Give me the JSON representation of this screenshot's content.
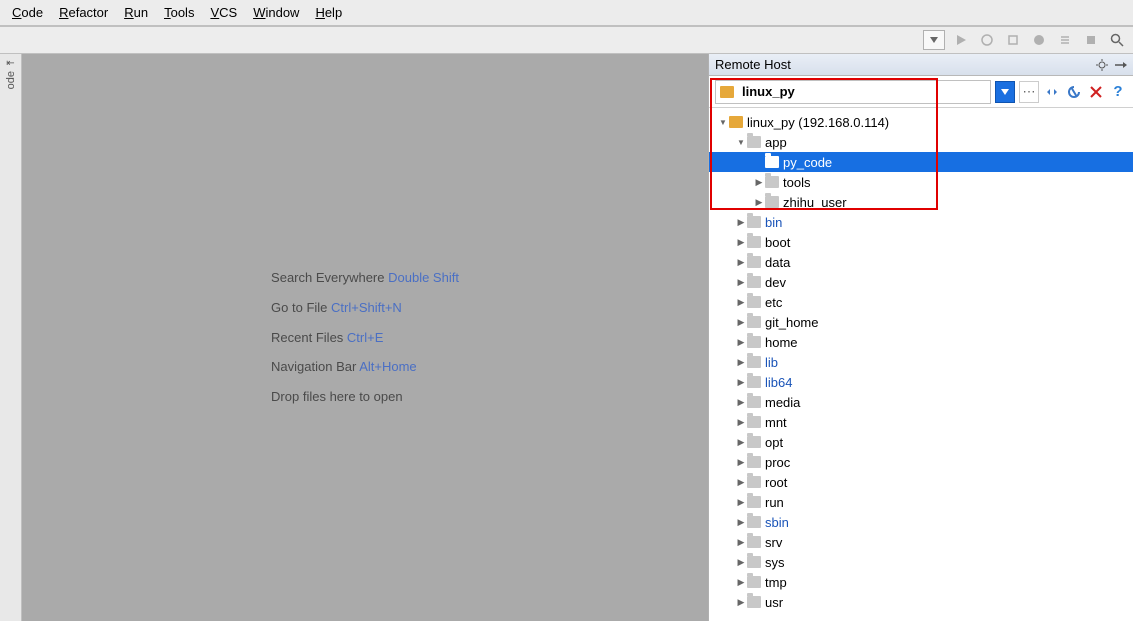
{
  "menu": [
    "Code",
    "Refactor",
    "Run",
    "Tools",
    "VCS",
    "Window",
    "Help"
  ],
  "leftbar": {
    "label": "ode"
  },
  "editor_hints": [
    {
      "label": "Search Everywhere ",
      "shortcut": "Double Shift"
    },
    {
      "label": "Go to File ",
      "shortcut": "Ctrl+Shift+N"
    },
    {
      "label": "Recent Files ",
      "shortcut": "Ctrl+E"
    },
    {
      "label": "Navigation Bar ",
      "shortcut": "Alt+Home"
    },
    {
      "label": "Drop files here to open",
      "shortcut": ""
    }
  ],
  "panel": {
    "title": "Remote Host",
    "server_name": "linux_py"
  },
  "tree": [
    {
      "depth": 0,
      "arrow": "down",
      "icon": "server",
      "label": "linux_py (192.168.0.114)",
      "link": false,
      "selected": false
    },
    {
      "depth": 1,
      "arrow": "down",
      "icon": "folder",
      "label": "app",
      "link": false,
      "selected": false
    },
    {
      "depth": 2,
      "arrow": "",
      "icon": "folder",
      "label": "py_code",
      "link": false,
      "selected": true
    },
    {
      "depth": 2,
      "arrow": "right",
      "icon": "folder",
      "label": "tools",
      "link": false,
      "selected": false
    },
    {
      "depth": 2,
      "arrow": "right",
      "icon": "folder",
      "label": "zhihu_user",
      "link": false,
      "selected": false
    },
    {
      "depth": 1,
      "arrow": "right",
      "icon": "folder",
      "label": "bin",
      "link": true,
      "selected": false
    },
    {
      "depth": 1,
      "arrow": "right",
      "icon": "folder",
      "label": "boot",
      "link": false,
      "selected": false
    },
    {
      "depth": 1,
      "arrow": "right",
      "icon": "folder",
      "label": "data",
      "link": false,
      "selected": false
    },
    {
      "depth": 1,
      "arrow": "right",
      "icon": "folder",
      "label": "dev",
      "link": false,
      "selected": false
    },
    {
      "depth": 1,
      "arrow": "right",
      "icon": "folder",
      "label": "etc",
      "link": false,
      "selected": false
    },
    {
      "depth": 1,
      "arrow": "right",
      "icon": "folder",
      "label": "git_home",
      "link": false,
      "selected": false
    },
    {
      "depth": 1,
      "arrow": "right",
      "icon": "folder",
      "label": "home",
      "link": false,
      "selected": false
    },
    {
      "depth": 1,
      "arrow": "right",
      "icon": "folder",
      "label": "lib",
      "link": true,
      "selected": false
    },
    {
      "depth": 1,
      "arrow": "right",
      "icon": "folder",
      "label": "lib64",
      "link": true,
      "selected": false
    },
    {
      "depth": 1,
      "arrow": "right",
      "icon": "folder",
      "label": "media",
      "link": false,
      "selected": false
    },
    {
      "depth": 1,
      "arrow": "right",
      "icon": "folder",
      "label": "mnt",
      "link": false,
      "selected": false
    },
    {
      "depth": 1,
      "arrow": "right",
      "icon": "folder",
      "label": "opt",
      "link": false,
      "selected": false
    },
    {
      "depth": 1,
      "arrow": "right",
      "icon": "folder",
      "label": "proc",
      "link": false,
      "selected": false
    },
    {
      "depth": 1,
      "arrow": "right",
      "icon": "folder",
      "label": "root",
      "link": false,
      "selected": false
    },
    {
      "depth": 1,
      "arrow": "right",
      "icon": "folder",
      "label": "run",
      "link": false,
      "selected": false
    },
    {
      "depth": 1,
      "arrow": "right",
      "icon": "folder",
      "label": "sbin",
      "link": true,
      "selected": false
    },
    {
      "depth": 1,
      "arrow": "right",
      "icon": "folder",
      "label": "srv",
      "link": false,
      "selected": false
    },
    {
      "depth": 1,
      "arrow": "right",
      "icon": "folder",
      "label": "sys",
      "link": false,
      "selected": false
    },
    {
      "depth": 1,
      "arrow": "right",
      "icon": "folder",
      "label": "tmp",
      "link": false,
      "selected": false
    },
    {
      "depth": 1,
      "arrow": "right",
      "icon": "folder",
      "label": "usr",
      "link": false,
      "selected": false
    }
  ]
}
